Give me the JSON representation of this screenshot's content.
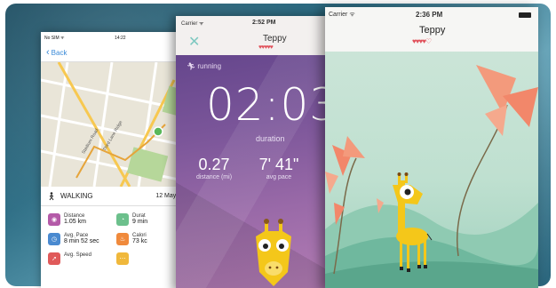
{
  "phone_walking": {
    "status": {
      "carrier": "No SIM ᯤ",
      "time": "14:22"
    },
    "nav": {
      "back_label": "Back"
    },
    "map": {
      "street_label": "Stadium Road",
      "street_label_2": "Third Lane Ridge"
    },
    "activity": {
      "label": "WALKING",
      "date": "12 May 20"
    },
    "stats": [
      {
        "label": "Distance",
        "value": "1.05 km",
        "color": "#b45aa8",
        "icon": "map-pin-icon"
      },
      {
        "label": "Durat",
        "value": "9 min",
        "color": "#6cc08c",
        "icon": "clock-icon"
      },
      {
        "label": "Avg. Pace",
        "value": "8 min 52 sec",
        "color": "#4a8ad0",
        "icon": "pace-icon"
      },
      {
        "label": "Calori",
        "value": "73 kc",
        "color": "#f08a3c",
        "icon": "flame-icon"
      },
      {
        "label": "Avg. Speed",
        "value": "",
        "color": "#e05a5a",
        "icon": "speed-icon"
      },
      {
        "label": "",
        "value": "",
        "color": "#f0b83c",
        "icon": "steps-icon"
      }
    ]
  },
  "phone_running": {
    "status": {
      "carrier": "Carrier ᯤ",
      "time": "2:52 PM"
    },
    "close_icon": "close-icon",
    "title": "Teppy",
    "hearts": "♥♥♥♥♥",
    "mode": "running",
    "clock": "02:03",
    "duration_label": "duration",
    "metrics": [
      {
        "value": "0.27",
        "label": "distance (mi)"
      },
      {
        "value": "7' 41\"",
        "label": "avg pace"
      }
    ]
  },
  "phone_teppy": {
    "status": {
      "carrier": "Carrier ᯤ",
      "time": "2:36 PM"
    },
    "title": "Teppy",
    "hearts": "♥♥♥♥♡"
  },
  "colors": {
    "accent_blue": "#3a8ad8",
    "purple": "#7a5599",
    "mint": "#bfe0d0",
    "heart": "#e0505a",
    "giraffe": "#f4c71a"
  }
}
